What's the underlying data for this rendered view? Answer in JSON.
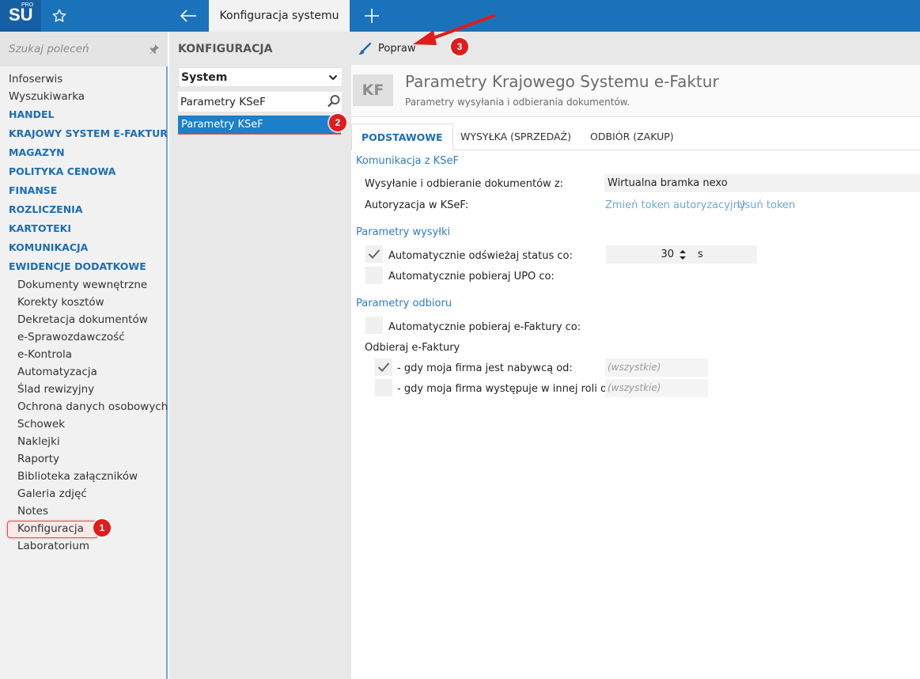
{
  "topbar": {
    "logo_text": "SU",
    "logo_sup": "PRO",
    "tab_title": "Konfiguracja systemu",
    "icons": [
      "star-icon",
      "back-arrow-icon",
      "plus-icon"
    ],
    "bg_color": "#1a72bb"
  },
  "sidebar": {
    "search_placeholder": "Szukaj poleceń",
    "items": [
      {
        "label": "Infoserwis",
        "kind": "item"
      },
      {
        "label": "Wyszukiwarka",
        "kind": "item"
      },
      {
        "label": "HANDEL",
        "kind": "cat"
      },
      {
        "label": "KRAJOWY SYSTEM E-FAKTUR",
        "kind": "cat"
      },
      {
        "label": "MAGAZYN",
        "kind": "cat"
      },
      {
        "label": "POLITYKA CENOWA",
        "kind": "cat"
      },
      {
        "label": "FINANSE",
        "kind": "cat"
      },
      {
        "label": "ROZLICZENIA",
        "kind": "cat"
      },
      {
        "label": "KARTOTEKI",
        "kind": "cat"
      },
      {
        "label": "KOMUNIKACJA",
        "kind": "cat"
      },
      {
        "label": "EWIDENCJE DODATKOWE",
        "kind": "cat"
      },
      {
        "label": "Dokumenty wewnętrzne",
        "kind": "sub"
      },
      {
        "label": "Korekty kosztów",
        "kind": "sub"
      },
      {
        "label": "Dekretacja dokumentów",
        "kind": "sub"
      },
      {
        "label": "e-Sprawozdawczość",
        "kind": "sub"
      },
      {
        "label": "e-Kontrola",
        "kind": "sub"
      },
      {
        "label": "Automatyzacja",
        "kind": "sub"
      },
      {
        "label": "Ślad rewizyjny",
        "kind": "sub"
      },
      {
        "label": "Ochrona danych osobowych",
        "kind": "sub"
      },
      {
        "label": "Schowek",
        "kind": "sub"
      },
      {
        "label": "Naklejki",
        "kind": "sub"
      },
      {
        "label": "Raporty",
        "kind": "sub"
      },
      {
        "label": "Biblioteka załączników",
        "kind": "sub"
      },
      {
        "label": "Galeria zdjęć",
        "kind": "sub"
      },
      {
        "label": "Notes",
        "kind": "sub"
      },
      {
        "label": "Konfiguracja",
        "kind": "sub",
        "highlighted": true
      },
      {
        "label": "Laboratorium",
        "kind": "sub"
      }
    ]
  },
  "middle": {
    "title": "KONFIGURACJA",
    "select_value": "System",
    "search_value": "Parametry KSeF",
    "list": [
      {
        "label": "Parametry KSeF",
        "selected": true
      }
    ]
  },
  "main": {
    "toolbar": {
      "edit_label": "Popraw"
    },
    "header": {
      "badge": "KF",
      "title": "Parametry Krajowego Systemu e-Faktur",
      "subtitle": "Parametry wysyłania i odbierania dokumentów."
    },
    "tabs": [
      {
        "label": "PODSTAWOWE",
        "active": true
      },
      {
        "label": "WYSYŁKA (SPRZEDAŻ)",
        "active": false
      },
      {
        "label": "ODBIÓR (ZAKUP)",
        "active": false
      }
    ],
    "sections": {
      "komunikacja": {
        "title": "Komunikacja z KSeF",
        "send_label": "Wysyłanie i odbieranie dokumentów z:",
        "send_value": "Wirtualna bramka nexo",
        "auth_label": "Autoryzacja w KSeF:",
        "change_token": "Zmień token autoryzacyjny",
        "remove_token": "Usuń token"
      },
      "wysylki": {
        "title": "Parametry wysyłki",
        "refresh_label": "Automatycznie odświeżaj status co:",
        "refresh_checked": true,
        "refresh_value": "30",
        "refresh_unit": "s",
        "upo_label": "Automatycznie pobieraj UPO co:",
        "upo_checked": false
      },
      "odbioru": {
        "title": "Parametry odbioru",
        "auto_label": "Automatycznie pobieraj e-Faktury co:",
        "auto_checked": false,
        "receive_title": "Odbieraj e-Faktury",
        "buyer_label": "- gdy moja firma jest nabywcą od:",
        "buyer_checked": true,
        "buyer_value": "(wszystkie)",
        "other_label": "- gdy moja firma występuje w innej roli od:",
        "other_checked": false,
        "other_value": "(wszystkie)"
      }
    }
  },
  "annotations": {
    "badge_1": "1",
    "badge_2": "2",
    "badge_3": "3",
    "color": "#e21b1b"
  }
}
